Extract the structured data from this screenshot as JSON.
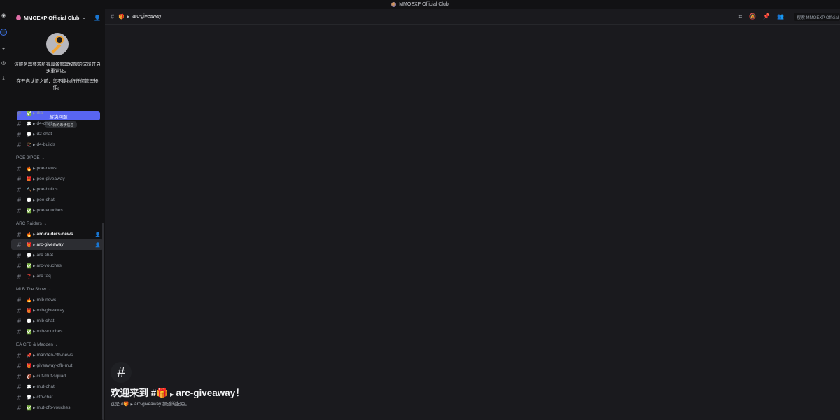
{
  "window": {
    "title": "MMOEXP Official Club"
  },
  "server": {
    "name": "MMOEXP Official Club"
  },
  "notice": {
    "text1": "该服务器要求所有具备管理权限的成员开启多重认证。",
    "text2": "在开启认证之前，您不能执行任何管理操作。",
    "button_label": "解决问题"
  },
  "tooltip": "← 新的未读信息",
  "groups": [
    {
      "category": null,
      "items": [
        {
          "emoji": "✅",
          "name": "dia",
          "unread": false,
          "active": false
        },
        {
          "emoji": "💬",
          "name": "d4-chat",
          "unread": false,
          "active": false
        },
        {
          "emoji": "💬",
          "name": "d2-chat",
          "unread": false,
          "active": false
        },
        {
          "emoji": "🏹",
          "name": "d4-builds",
          "unread": false,
          "active": false
        }
      ]
    },
    {
      "category": "POE 2/POE",
      "items": [
        {
          "emoji": "🔥",
          "name": "poe-news",
          "unread": false,
          "active": false
        },
        {
          "emoji": "🎁",
          "name": "poe-giveaway",
          "unread": false,
          "active": false
        },
        {
          "emoji": "🔨",
          "name": "poe-builds",
          "unread": false,
          "active": false
        },
        {
          "emoji": "💬",
          "name": "poe-chat",
          "unread": false,
          "active": false
        },
        {
          "emoji": "✅",
          "name": "poe-vouches",
          "unread": false,
          "active": false
        }
      ]
    },
    {
      "category": "ARC Raiders",
      "items": [
        {
          "emoji": "🔥",
          "name": "arc-raiders-news",
          "unread": true,
          "active": false
        },
        {
          "emoji": "🎁",
          "name": "arc-giveaway",
          "unread": false,
          "active": true
        },
        {
          "emoji": "💬",
          "name": "arc-chat",
          "unread": false,
          "active": false
        },
        {
          "emoji": "✅",
          "name": "arc-vouches",
          "unread": false,
          "active": false
        },
        {
          "emoji": "❓",
          "name": "arc-faq",
          "unread": false,
          "active": false
        }
      ]
    },
    {
      "category": "MLB The Show",
      "items": [
        {
          "emoji": "🔥",
          "name": "mlb-news",
          "unread": false,
          "active": false
        },
        {
          "emoji": "🎁",
          "name": "mlb-giveaway",
          "unread": false,
          "active": false
        },
        {
          "emoji": "💬",
          "name": "mlb-chat",
          "unread": false,
          "active": false
        },
        {
          "emoji": "✅",
          "name": "mlb-vouches",
          "unread": false,
          "active": false
        }
      ]
    },
    {
      "category": "EA CFB & Madden",
      "items": [
        {
          "emoji": "📌",
          "name": "madden-cfb-news",
          "unread": false,
          "active": false
        },
        {
          "emoji": "🎁",
          "name": "giveaway-cfb-mut",
          "unread": false,
          "active": false
        },
        {
          "emoji": "🏈",
          "name": "cut-mut-squad",
          "unread": false,
          "active": false
        },
        {
          "emoji": "💬",
          "name": "mut-chat",
          "unread": false,
          "active": false
        },
        {
          "emoji": "💬",
          "name": "cfb-chat",
          "unread": false,
          "active": false
        },
        {
          "emoji": "✅",
          "name": "mut-cfb-vouches",
          "unread": false,
          "active": false
        }
      ]
    }
  ],
  "topbar": {
    "channel_emoji": "🎁",
    "channel_name": "arc-giveaway"
  },
  "search": {
    "placeholder": "搜索 MMOEXP Official C"
  },
  "welcome": {
    "title_prefix": "欢迎来到 #",
    "title_emoji": "🎁",
    "channel_name": "arc-giveaway",
    "title_suffix": "！",
    "sub_prefix": "这是 #",
    "sub_emoji": "🎁",
    "sub_channel": "arc-giveaway",
    "sub_suffix": " 频道的起点。"
  },
  "icons": {
    "rail": [
      "discord-icon",
      "server-icon",
      "add-server-icon",
      "explore-icon",
      "download-icon"
    ],
    "toolbar": [
      "threads-icon",
      "mute-icon",
      "pin-icon",
      "members-icon"
    ]
  }
}
